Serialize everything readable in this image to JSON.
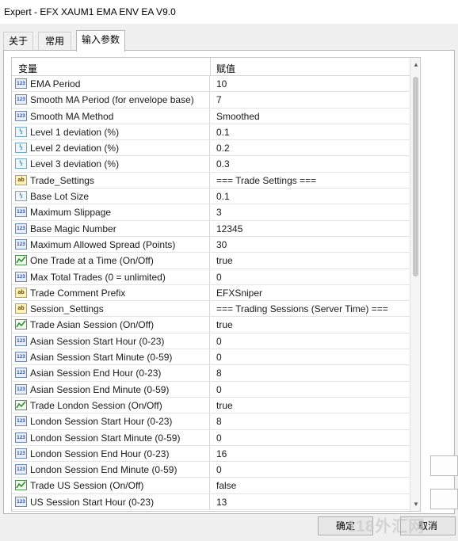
{
  "window": {
    "title": "Expert - EFX XAUM1 EMA ENV EA V9.0"
  },
  "tabs": [
    {
      "label": "关于"
    },
    {
      "label": "常用"
    },
    {
      "label": "输入参数"
    }
  ],
  "grid": {
    "header": {
      "variable": "变量",
      "value": "赋值"
    },
    "rows": [
      {
        "type": "int",
        "name": "EMA Period",
        "value": "10"
      },
      {
        "type": "int",
        "name": "Smooth MA Period (for envelope base)",
        "value": "7"
      },
      {
        "type": "int",
        "name": "Smooth MA Method",
        "value": "Smoothed"
      },
      {
        "type": "double",
        "name": "Level 1 deviation (%)",
        "value": "0.1"
      },
      {
        "type": "double",
        "name": "Level 2 deviation (%)",
        "value": "0.2"
      },
      {
        "type": "double",
        "name": "Level 3 deviation (%)",
        "value": "0.3"
      },
      {
        "type": "string",
        "name": "Trade_Settings",
        "value": "=== Trade Settings ==="
      },
      {
        "type": "double",
        "name": "Base Lot Size",
        "value": "0.1"
      },
      {
        "type": "int",
        "name": "Maximum Slippage",
        "value": "3"
      },
      {
        "type": "int",
        "name": "Base Magic Number",
        "value": "12345"
      },
      {
        "type": "int",
        "name": "Maximum Allowed Spread (Points)",
        "value": "30"
      },
      {
        "type": "bool",
        "name": "One Trade at a Time (On/Off)",
        "value": "true"
      },
      {
        "type": "int",
        "name": "Max Total Trades (0 = unlimited)",
        "value": "0"
      },
      {
        "type": "string",
        "name": "Trade Comment Prefix",
        "value": "EFXSniper"
      },
      {
        "type": "string",
        "name": "Session_Settings",
        "value": "=== Trading Sessions (Server Time) ==="
      },
      {
        "type": "bool",
        "name": "Trade Asian Session (On/Off)",
        "value": "true"
      },
      {
        "type": "int",
        "name": "Asian Session Start Hour (0-23)",
        "value": "0"
      },
      {
        "type": "int",
        "name": "Asian Session Start Minute (0-59)",
        "value": "0"
      },
      {
        "type": "int",
        "name": "Asian Session End Hour (0-23)",
        "value": "8"
      },
      {
        "type": "int",
        "name": "Asian Session End Minute (0-59)",
        "value": "0"
      },
      {
        "type": "bool",
        "name": "Trade London Session (On/Off)",
        "value": "true"
      },
      {
        "type": "int",
        "name": "London Session Start Hour (0-23)",
        "value": "8"
      },
      {
        "type": "int",
        "name": "London Session Start Minute (0-59)",
        "value": "0"
      },
      {
        "type": "int",
        "name": "London Session End Hour (0-23)",
        "value": "16"
      },
      {
        "type": "int",
        "name": "London Session End Minute (0-59)",
        "value": "0"
      },
      {
        "type": "bool",
        "name": "Trade US Session (On/Off)",
        "value": "false"
      },
      {
        "type": "int",
        "name": "US Session Start Hour (0-23)",
        "value": "13"
      }
    ]
  },
  "icons": {
    "int": {
      "name": "int-type-icon",
      "glyph": "123"
    },
    "double": {
      "name": "double-type-icon",
      "glyph": "½"
    },
    "string": {
      "name": "string-type-icon",
      "glyph": "ab"
    },
    "bool": {
      "name": "bool-type-icon",
      "glyph": ""
    }
  },
  "buttons": {
    "ok": "确定",
    "cancel": "取消"
  },
  "watermark": "118外汇网"
}
